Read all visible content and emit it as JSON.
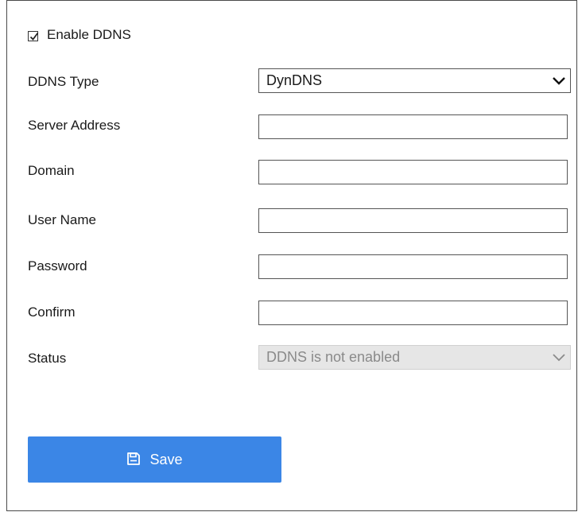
{
  "form": {
    "enable_ddns": {
      "label": "Enable DDNS",
      "checked": true
    },
    "fields": {
      "ddns_type": {
        "label": "DDNS Type",
        "value": "DynDNS"
      },
      "server_address": {
        "label": "Server Address",
        "value": ""
      },
      "domain": {
        "label": "Domain",
        "value": ""
      },
      "user_name": {
        "label": "User Name",
        "value": ""
      },
      "password": {
        "label": "Password",
        "value": ""
      },
      "confirm": {
        "label": "Confirm",
        "value": ""
      },
      "status": {
        "label": "Status",
        "value": "DDNS is not enabled",
        "disabled": true
      }
    },
    "save_button": {
      "label": "Save",
      "icon": "floppy-disk-icon"
    }
  },
  "colors": {
    "primary": "#3b86e6",
    "border": "#555555",
    "disabled_bg": "#e6e6e6",
    "disabled_text": "#8a8a8a"
  }
}
